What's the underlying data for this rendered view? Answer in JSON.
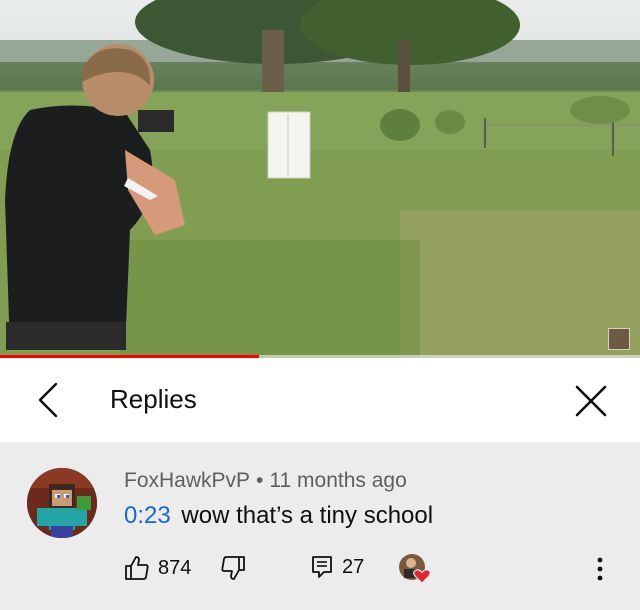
{
  "video": {
    "progress": 0.405,
    "progress_color": "#ff0000"
  },
  "header": {
    "back_icon": "chevron-left-icon",
    "title": "Replies",
    "close_icon": "close-icon"
  },
  "comment": {
    "author": "FoxHawkPvP",
    "separator": "•",
    "age": "11 months ago",
    "timestamp": "0:23",
    "text": "wow that’s a tiny school",
    "likes": "874",
    "replies": "27",
    "link_color": "#1a66d6",
    "icons": {
      "like": "thumbs-up-icon",
      "dislike": "thumbs-down-icon",
      "reply": "reply-icon",
      "hearted": "creator-heart-icon",
      "more": "more-vertical-icon"
    }
  }
}
